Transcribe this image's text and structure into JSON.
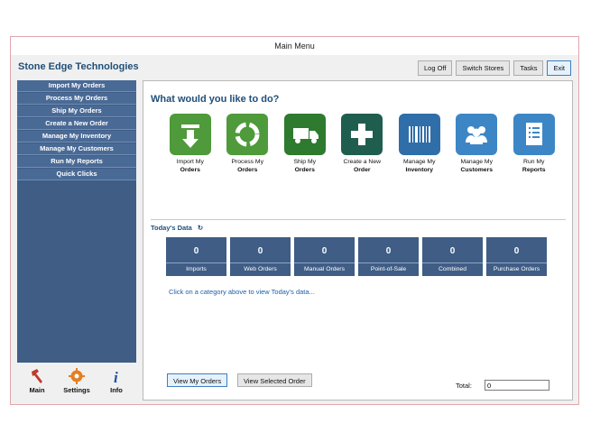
{
  "window": {
    "title": "Main Menu"
  },
  "app": {
    "title": "Stone Edge Technologies"
  },
  "top_buttons": {
    "logoff": "Log Off",
    "switch": "Switch Stores",
    "tasks": "Tasks",
    "exit": "Exit"
  },
  "sidebar": {
    "items": [
      {
        "label": "Import My Orders"
      },
      {
        "label": "Process My Orders"
      },
      {
        "label": "Ship My Orders"
      },
      {
        "label": "Create a New Order"
      },
      {
        "label": "Manage My Inventory"
      },
      {
        "label": "Manage My Customers"
      },
      {
        "label": "Run My Reports"
      },
      {
        "label": "Quick Clicks"
      }
    ]
  },
  "bottom": {
    "main": {
      "label": "Main",
      "icon": "hammer-icon"
    },
    "settings": {
      "label": "Settings",
      "icon": "gear-icon"
    },
    "info": {
      "label": "Info",
      "icon": "info-icon"
    }
  },
  "main": {
    "heading": "What would you like to do?",
    "tiles": [
      {
        "line1": "Import My",
        "line2": "Orders",
        "color": "#4f9a3a",
        "icon": "import-arrow-icon"
      },
      {
        "line1": "Process My",
        "line2": "Orders",
        "color": "#4f9a3a",
        "icon": "recycle-icon"
      },
      {
        "line1": "Ship My",
        "line2": "Orders",
        "color": "#2e7a2e",
        "icon": "truck-icon"
      },
      {
        "line1": "Create a New",
        "line2": "Order",
        "color": "#1f5e4e",
        "icon": "plus-icon"
      },
      {
        "line1": "Manage My",
        "line2": "Inventory",
        "color": "#2f6ea8",
        "icon": "barcode-icon"
      },
      {
        "line1": "Manage My",
        "line2": "Customers",
        "color": "#3d86c6",
        "icon": "people-icon"
      },
      {
        "line1": "Run My",
        "line2": "Reports",
        "color": "#3d86c6",
        "icon": "report-icon"
      }
    ],
    "today_label": "Today's Data",
    "stats": [
      {
        "value": "0",
        "label": "Imports"
      },
      {
        "value": "0",
        "label": "Web Orders"
      },
      {
        "value": "0",
        "label": "Manual Orders"
      },
      {
        "value": "0",
        "label": "Point-of-Sale"
      },
      {
        "value": "0",
        "label": "Combined"
      },
      {
        "value": "0",
        "label": "Purchase Orders"
      }
    ],
    "hint": "Click on a category above to view Today's data...",
    "view_my_orders": "View My Orders",
    "view_selected": "View Selected Order",
    "total_label": "Total:",
    "total_value": "0"
  }
}
